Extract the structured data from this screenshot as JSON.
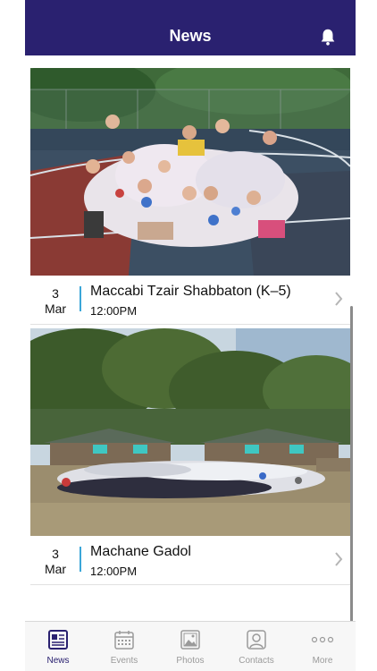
{
  "header": {
    "title": "News"
  },
  "events": [
    {
      "day": "3",
      "month": "Mar",
      "title": "Maccabi Tzair Shabbaton (K–5)",
      "time": "12:00PM"
    },
    {
      "day": "3",
      "month": "Mar",
      "title": "Machane Gadol",
      "time": "12:00PM"
    }
  ],
  "tabs": [
    {
      "label": "News",
      "icon": "newspaper-icon"
    },
    {
      "label": "Events",
      "icon": "calendar-icon"
    },
    {
      "label": "Photos",
      "icon": "photo-icon"
    },
    {
      "label": "Contacts",
      "icon": "contact-icon"
    },
    {
      "label": "More",
      "icon": "more-dots-icon"
    }
  ],
  "colors": {
    "header": "#2a2170",
    "accent": "#3aa6d8",
    "tab_active": "#2a2170",
    "tab_inactive": "#9a9a9a"
  }
}
